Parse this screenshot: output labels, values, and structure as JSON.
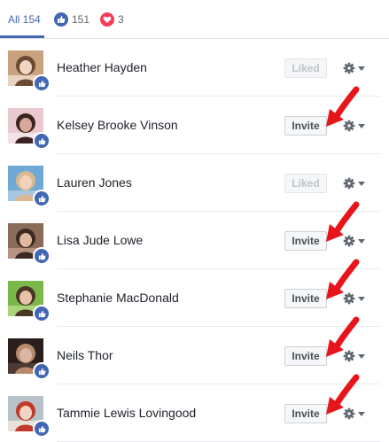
{
  "tabs": {
    "all": "All 154",
    "like_count": "151",
    "love_count": "3"
  },
  "colors": {
    "accent": "#4267b2",
    "love": "#f33e58",
    "arrow": "#e8141b"
  },
  "people": [
    {
      "name": "Heather Hayden",
      "button": "Liked",
      "state": "liked",
      "arrow": false
    },
    {
      "name": "Kelsey Brooke Vinson",
      "button": "Invite",
      "state": "invite",
      "arrow": true
    },
    {
      "name": "Lauren Jones",
      "button": "Liked",
      "state": "liked",
      "arrow": false
    },
    {
      "name": "Lisa Jude Lowe",
      "button": "Invite",
      "state": "invite",
      "arrow": true
    },
    {
      "name": "Stephanie MacDonald",
      "button": "Invite",
      "state": "invite",
      "arrow": true
    },
    {
      "name": "Neils Thor",
      "button": "Invite",
      "state": "invite",
      "arrow": true
    },
    {
      "name": "Tammie Lewis Lovingood",
      "button": "Invite",
      "state": "invite",
      "arrow": true
    }
  ]
}
